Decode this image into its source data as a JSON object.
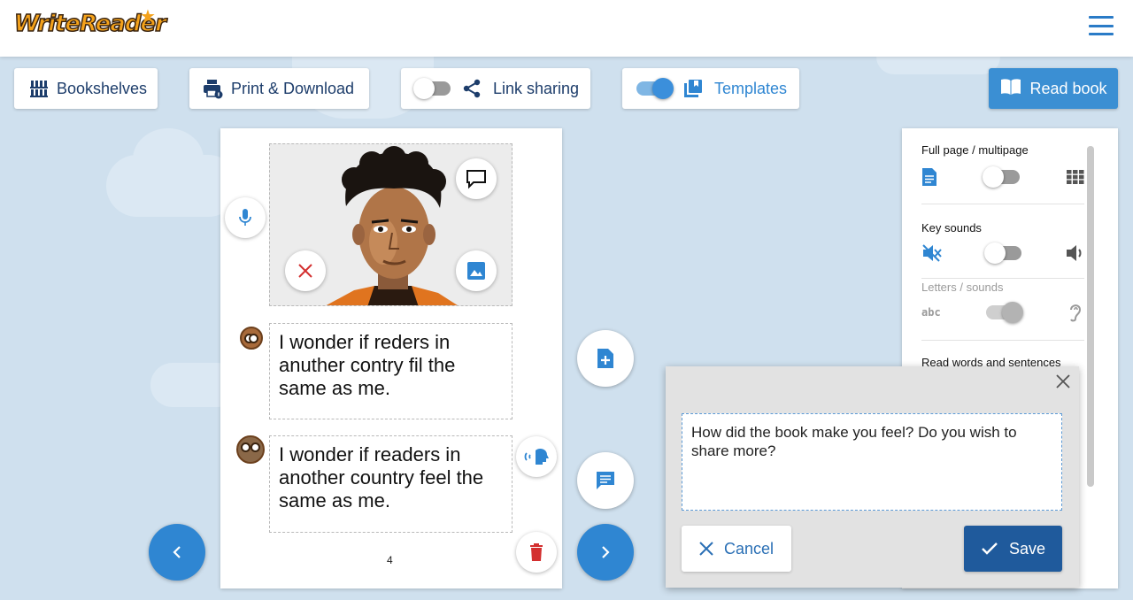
{
  "app": {
    "logo_text": "WriteReader"
  },
  "toolbar": {
    "bookshelves_label": "Bookshelves",
    "print_label": "Print & Download",
    "link_sharing_label": "Link sharing",
    "link_sharing_on": false,
    "templates_label": "Templates",
    "templates_on": true,
    "read_book_label": "Read book"
  },
  "page": {
    "number": "4",
    "child_text": "I wonder if reders in anuther contry fil the same as me.",
    "adult_text": "I wonder if readers in another country feel the same as me."
  },
  "settings": {
    "full_page_label": "Full page / multipage",
    "full_page_on": false,
    "key_sounds_label": "Key sounds",
    "key_sounds_on": false,
    "letters_sounds_label": "Letters / sounds",
    "letters_sounds_on": true,
    "read_words_label": "Read words and sentences"
  },
  "dialog": {
    "text": "How did the book make you feel? Do you wish to share more?",
    "cancel_label": "Cancel",
    "save_label": "Save"
  },
  "colors": {
    "primary": "#2f86d2",
    "save": "#1f5a9c",
    "delete": "#d32f2f",
    "background": "#cfe0ee"
  }
}
